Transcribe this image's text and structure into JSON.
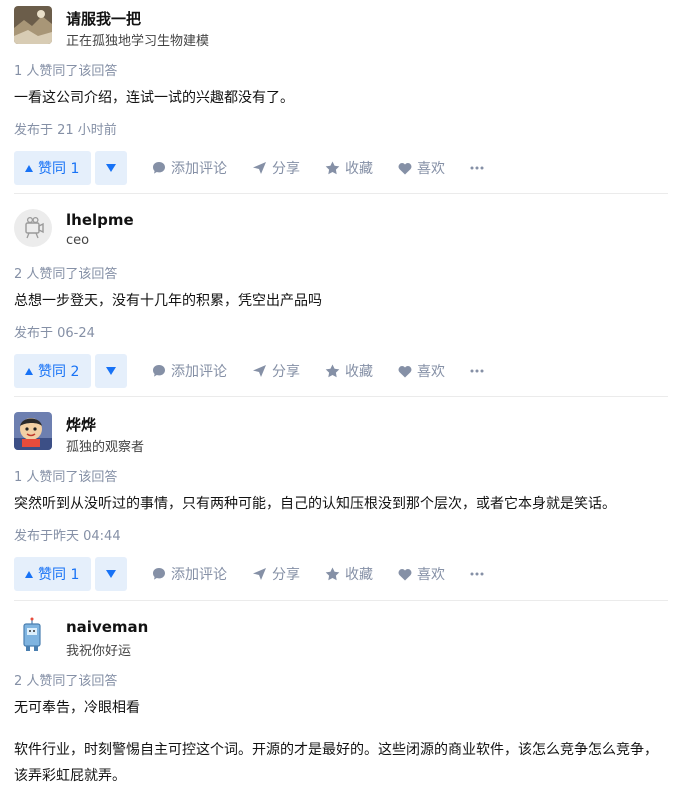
{
  "answers": [
    {
      "author": "请服我一把",
      "headline": "正在孤独地学习生物建模",
      "votes_text": "1 人赞同了该回答",
      "content": [
        "一看这公司介绍，连试一试的兴趣都没有了。"
      ],
      "time": "发布于 21 小时前",
      "upvote_label": "赞同 1",
      "avatar_icon": "landscape-photo-avatar"
    },
    {
      "author": "lhelpme",
      "headline": "ceo",
      "votes_text": "2 人赞同了该回答",
      "content": [
        "总想一步登天，没有十几年的积累，凭空出产品吗"
      ],
      "time": "发布于 06-24",
      "upvote_label": "赞同 2",
      "avatar_icon": "default-avatar"
    },
    {
      "author": "烨烨",
      "headline": "孤独的观察者",
      "votes_text": "1 人赞同了该回答",
      "content": [
        "突然听到从没听过的事情，只有两种可能，自己的认知压根没到那个层次，或者它本身就是笑话。"
      ],
      "time": "发布于昨天 04:44",
      "upvote_label": "赞同 1",
      "avatar_icon": "cartoon-avatar"
    },
    {
      "author": "naiveman",
      "headline": "我祝你好运",
      "votes_text": "2 人赞同了该回答",
      "content": [
        "无可奉告，冷眼相看",
        "软件行业，时刻警惕自主可控这个词。开源的才是最好的。这些闭源的商业软件，该怎么竞争怎么竞争，该弄彩虹屁就弄。"
      ],
      "time": "",
      "upvote_label": "",
      "avatar_icon": "robot-avatar"
    }
  ],
  "actions": {
    "comment": "添加评论",
    "share": "分享",
    "collect": "收藏",
    "like": "喜欢"
  },
  "colors": {
    "accent": "#1772f6",
    "vote_bg": "#e5effb",
    "meta": "#8590a6"
  }
}
